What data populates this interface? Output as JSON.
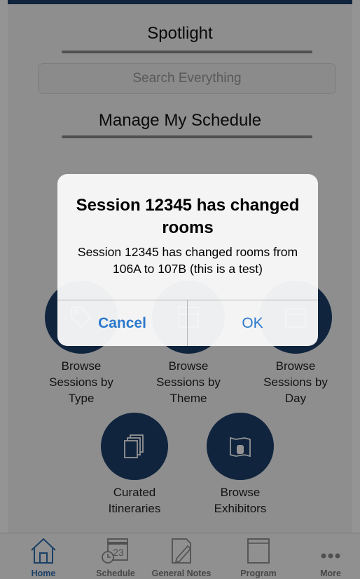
{
  "spotlight": {
    "title": "Spotlight",
    "search_placeholder": "Search Everything"
  },
  "schedule": {
    "title": "Manage My Schedule"
  },
  "tiles": [
    {
      "label": "Browse\nSessions by\nType",
      "icon": "tag-icon"
    },
    {
      "label": "Browse\nSessions by\nTheme",
      "icon": "theme-icon"
    },
    {
      "label": "Browse\nSessions by\nDay",
      "icon": "calendar-icon"
    },
    {
      "label": "Curated\nItineraries",
      "icon": "copy-pages-icon"
    },
    {
      "label": "Browse\nExhibitors",
      "icon": "map-icon"
    }
  ],
  "tabbar": {
    "items": [
      {
        "label": "Home",
        "icon": "home-icon",
        "active": true
      },
      {
        "label": "Schedule",
        "icon": "calendar-clock-icon",
        "active": false,
        "badge": "23"
      },
      {
        "label": "General Notes",
        "icon": "note-pencil-icon",
        "active": false
      },
      {
        "label": "Program",
        "icon": "book-icon",
        "active": false
      },
      {
        "label": "More",
        "icon": "more-dots-icon",
        "active": false
      }
    ]
  },
  "dialog": {
    "title": "Session 12345 has changed rooms",
    "message": "Session 12345 has changed rooms from 106A to 107B (this is a test)",
    "cancel_label": "Cancel",
    "ok_label": "OK"
  },
  "colors": {
    "brand_navy": "#1c3f69",
    "dialog_button_blue": "#2b79cc",
    "tab_active_blue": "#2f6fb0"
  }
}
